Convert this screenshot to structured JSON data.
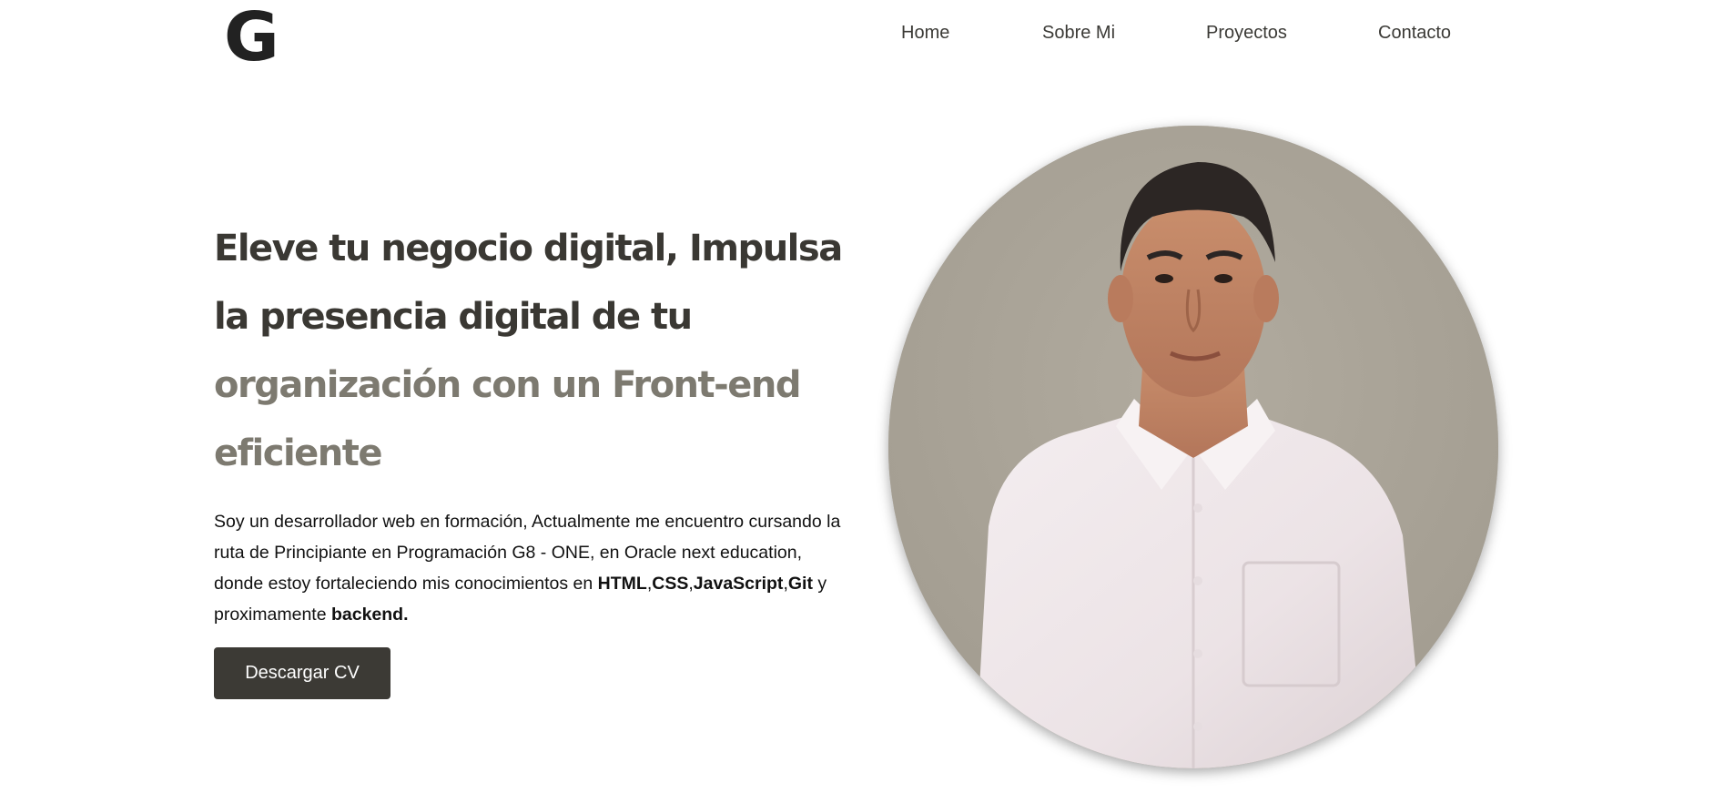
{
  "header": {
    "logo_letter": "G",
    "nav": {
      "home": "Home",
      "about": "Sobre Mi",
      "projects": "Proyectos",
      "contact": "Contacto"
    }
  },
  "hero": {
    "title_dark": "Eleve tu negocio digital, Impulsa la presencia digital de tu",
    "title_light": "organización con un Front-end eficiente",
    "description": {
      "intro": "Soy un desarrollador web en formación, Actualmente me encuentro cursando la ruta de Principiante en Programación G8 - ONE, en Oracle next education, donde estoy fortaleciendo mis conocimientos en ",
      "skill_1": "HTML",
      "sep_1": ",",
      "skill_2": "CSS",
      "sep_2": ",",
      "skill_3": "JavaScript",
      "sep_3": ",",
      "skill_4": "Git",
      "middle": " y proximamente ",
      "skill_5": "backend."
    },
    "cv_button": "Descargar CV"
  },
  "colors": {
    "title_dark": "#3a3833",
    "title_light": "#7d7a70",
    "button_bg": "#3c3a35",
    "portrait_bg": "#a9a397"
  }
}
